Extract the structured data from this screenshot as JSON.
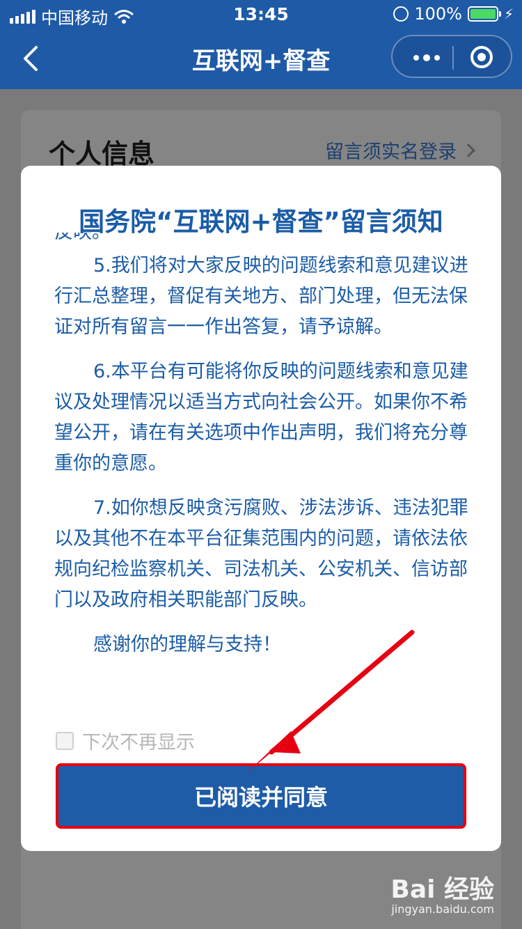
{
  "status_bar": {
    "carrier": "中国移动",
    "time": "13:45",
    "battery": "100%"
  },
  "nav": {
    "title": "互联网+督查"
  },
  "background": {
    "section_title": "个人信息",
    "login_link": "留言须实名登录"
  },
  "modal": {
    "title": "国务院“互联网+督查”留言须知",
    "partial_line": "反映。",
    "paragraphs": [
      "5.我们将对大家反映的问题线索和意见建议进行汇总整理，督促有关地方、部门处理，但无法保证对所有留言一一作出答复，请予谅解。",
      "6.本平台有可能将你反映的问题线索和意见建议及处理情况以适当方式向社会公开。如果你不希望公开，请在有关选项中作出声明，我们将充分尊重你的意愿。",
      "7.如你想反映贪污腐败、涉法涉诉、违法犯罪以及其他不在本平台征集范围内的问题，请依法依规向纪检监察机关、司法机关、公安机关、信访部门以及政府相关职能部门反映。",
      "感谢你的理解与支持！"
    ],
    "checkbox_label": "下次不再显示",
    "confirm_label": "已阅读并同意"
  },
  "watermark": {
    "brand": "Bai 经验",
    "url": "jingyan.baidu.com"
  },
  "colors": {
    "primary": "#1e5ca8",
    "annotation": "#e60012"
  }
}
